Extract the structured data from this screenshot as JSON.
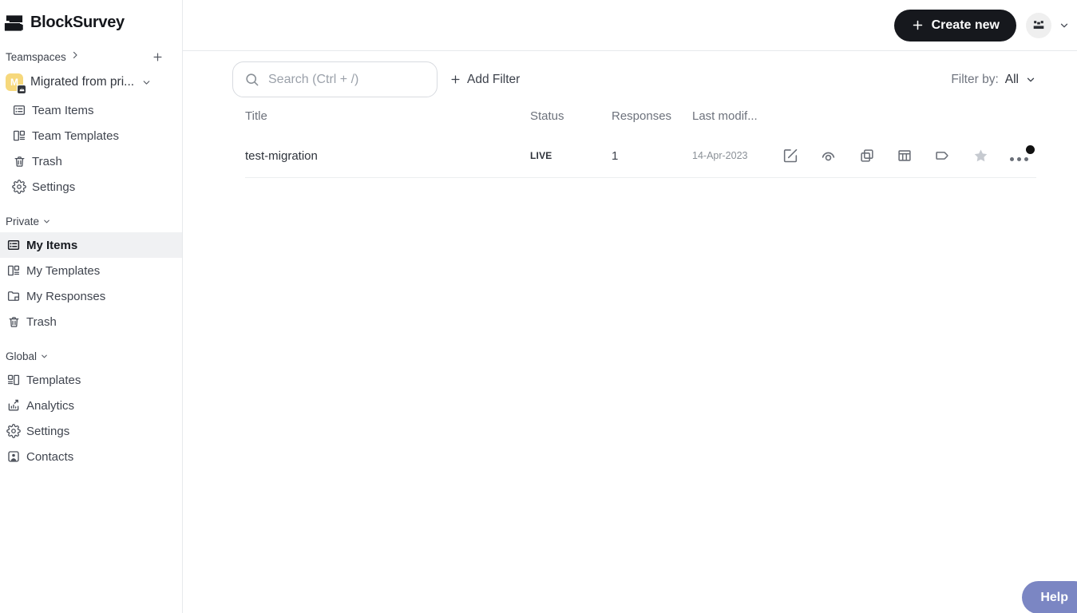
{
  "brand": {
    "name": "BlockSurvey"
  },
  "topbar": {
    "create_new_label": "Create new"
  },
  "sidebar": {
    "teamspaces_label": "Teamspaces",
    "teamspace": {
      "name": "Migrated from pri...",
      "initial": "M"
    },
    "team_items": [
      {
        "label": "Team Items",
        "icon": "list-icon"
      },
      {
        "label": "Team Templates",
        "icon": "templates-icon"
      },
      {
        "label": "Trash",
        "icon": "trash-icon"
      },
      {
        "label": "Settings",
        "icon": "gear-icon"
      }
    ],
    "private_label": "Private",
    "private_items": [
      {
        "label": "My Items",
        "icon": "list-icon",
        "selected": true
      },
      {
        "label": "My Templates",
        "icon": "templates-icon"
      },
      {
        "label": "My Responses",
        "icon": "folder-icon"
      },
      {
        "label": "Trash",
        "icon": "trash-icon"
      }
    ],
    "global_label": "Global",
    "global_items": [
      {
        "label": "Templates",
        "icon": "templates-global-icon"
      },
      {
        "label": "Analytics",
        "icon": "analytics-icon"
      },
      {
        "label": "Settings",
        "icon": "gear-icon"
      },
      {
        "label": "Contacts",
        "icon": "contacts-icon"
      }
    ]
  },
  "main": {
    "search_placeholder": "Search (Ctrl + /)",
    "add_filter_label": "Add Filter",
    "filter_by_label": "Filter by:",
    "filter_value": "All",
    "table": {
      "columns": [
        "Title",
        "Status",
        "Responses",
        "Last modif..."
      ],
      "rows": [
        {
          "title": "test-migration",
          "status": "LIVE",
          "responses": "1",
          "last_modified": "14-Apr-2023"
        }
      ],
      "row_actions": [
        "edit",
        "preview",
        "duplicate",
        "results",
        "tag",
        "favorite",
        "more"
      ]
    }
  },
  "help": {
    "label": "Help"
  },
  "colors": {
    "accent_dark": "#16181d",
    "help_blue": "#7b86c3",
    "teamspace_avatar": "#f6d87c",
    "selected_bg": "#f0f1f3",
    "border": "#e7e9ec"
  }
}
